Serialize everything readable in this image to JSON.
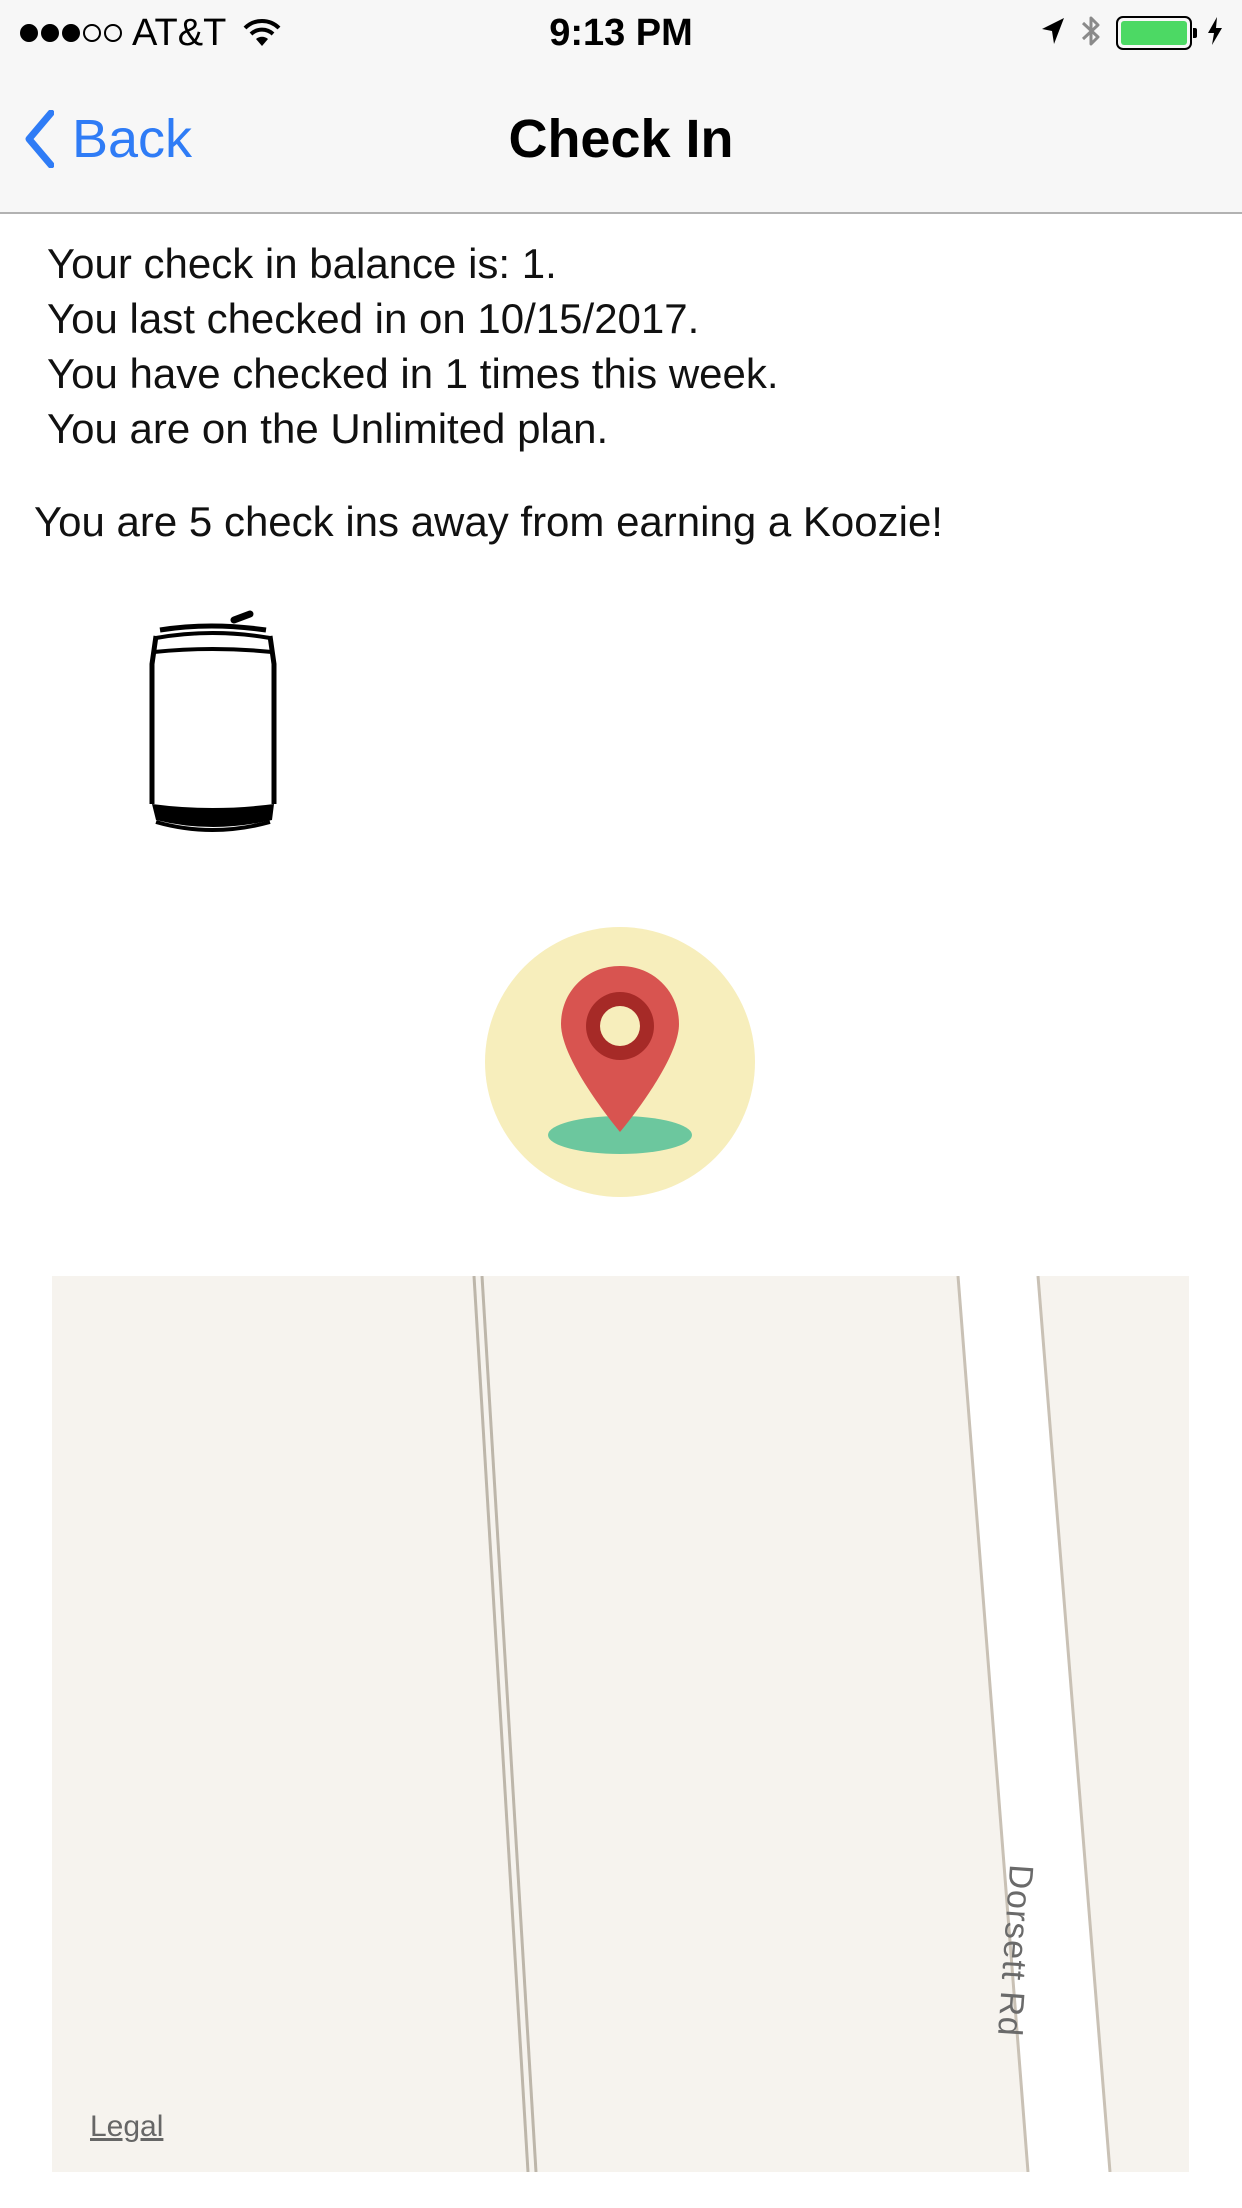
{
  "status_bar": {
    "carrier": "AT&T",
    "time": "9:13 PM",
    "battery_level": 1.0,
    "signal_bars_filled": 3,
    "signal_bars_total": 5
  },
  "nav": {
    "back_label": "Back",
    "title": "Check In"
  },
  "info": {
    "balance_line": "Your check in balance is: 1.",
    "last_checkin_line": "You last checked in on 10/15/2017.",
    "week_count_line": "You have checked in 1 times this week.",
    "plan_line": "You are on the Unlimited plan.",
    "koozie_line": "You are 5 check ins away from earning a Koozie!"
  },
  "icons": {
    "can": "beer-can-icon",
    "check_in": "map-pin-icon"
  },
  "map": {
    "road_label": "Dorsett Rd",
    "legal_label": "Legal"
  },
  "colors": {
    "accent": "#2f7cf6",
    "battery": "#4cd964",
    "pin_red": "#d85450",
    "pin_dark_red": "#a62a27",
    "pin_circle": "#f7eebc",
    "pin_shadow": "#6cc79e",
    "map_background": "#f6f3ee"
  }
}
